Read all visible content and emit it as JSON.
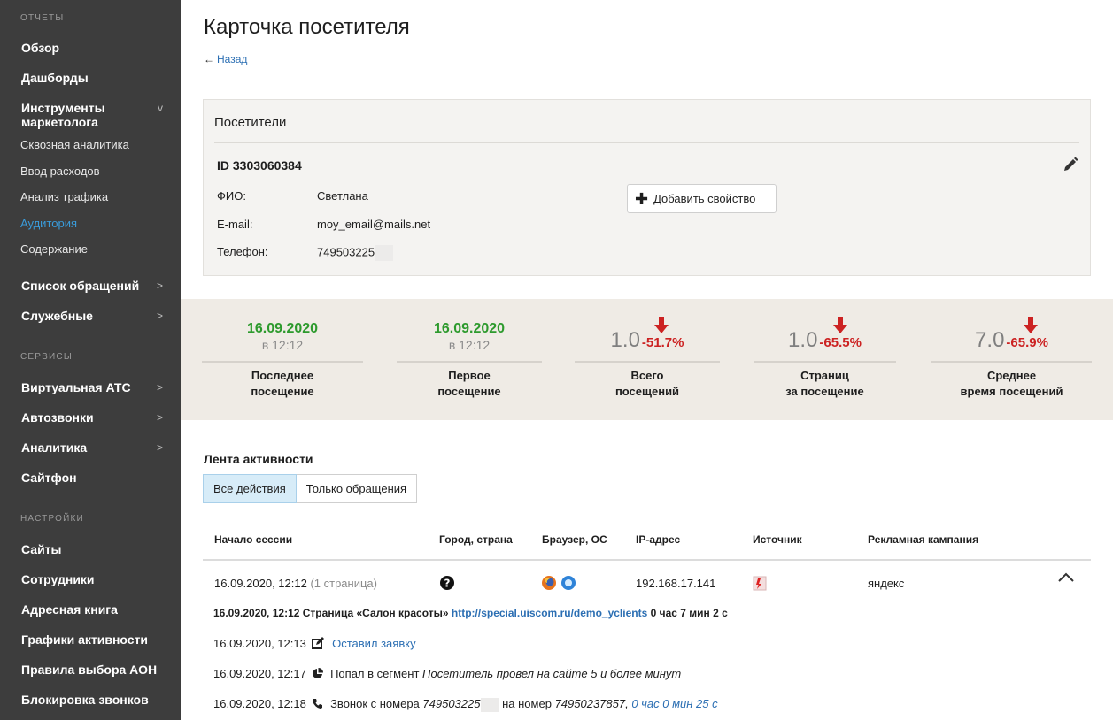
{
  "sidebar": {
    "section_reports": "ОТЧЕТЫ",
    "overview": "Обзор",
    "dashboards": "Дашборды",
    "marketer_tools": "Инструменты маркетолога",
    "marketer_tools_chevron": "v",
    "sub": [
      "Сквозная аналитика",
      "Ввод расходов",
      "Анализ трафика",
      "Аудитория",
      "Содержание"
    ],
    "requests_list": "Список обращений",
    "service": "Служебные",
    "section_services": "СЕРВИСЫ",
    "virtual_pbx": "Виртуальная АТС",
    "autocalls": "Автозвонки",
    "analytics": "Аналитика",
    "sitephone": "Сайтфон",
    "section_settings": "НАСТРОЙКИ",
    "sites": "Сайты",
    "employees": "Сотрудники",
    "address_book": "Адресная книга",
    "activity_charts": "Графики активности",
    "aon_rules": "Правила выбора АОН",
    "call_block": "Блокировка звонков",
    "chevron": ">"
  },
  "page": {
    "title": "Карточка посетителя",
    "back": "Назад"
  },
  "visitor": {
    "card_title": "Посетители",
    "id": "ID 3303060384",
    "name_label": "ФИО:",
    "name_value": "Светлана",
    "email_label": "E-mail:",
    "email_value": "moy_email@mails.net",
    "phone_label": "Телефон:",
    "phone_value": "749503225",
    "add_property": "Добавить свойство"
  },
  "stats": {
    "last_date": "16.09.2020",
    "last_time": "в 12:12",
    "last_label_1": "Последнее",
    "last_label_2": "посещение",
    "first_date": "16.09.2020",
    "first_time": "в 12:12",
    "first_label_1": "Первое",
    "first_label_2": "посещение",
    "total_value": "1.0",
    "total_pct": "-51.7%",
    "total_label_1": "Всего",
    "total_label_2": "посещений",
    "pages_value": "1.0",
    "pages_pct": "-65.5%",
    "pages_label_1": "Страниц",
    "pages_label_2": "за посещение",
    "time_value": "7.0",
    "time_pct": "-65.9%",
    "time_label_1": "Среднее",
    "time_label_2": "время посещений",
    "down_color": "#cc2222",
    "up_color": "#2d9a2d"
  },
  "feed": {
    "title": "Лента активности",
    "tab_all": "Все действия",
    "tab_requests": "Только обращения",
    "headers": {
      "session_start": "Начало сессии",
      "city": "Город, страна",
      "browser": "Браузер, ОС",
      "ip": "IP-адрес",
      "source": "Источник",
      "campaign": "Рекламная кампания"
    },
    "session": {
      "start": "16.09.2020, 12:12",
      "pages": "(1 страница)",
      "ip": "192.168.17.141",
      "campaign": "яндекс"
    },
    "events": {
      "e1_time": "16.09.2020, 12:12",
      "e1_text": "Страница «Салон красоты»",
      "e1_url": "http://special.uiscom.ru/demo_yclients",
      "e1_duration": "0 час 7 мин 2 с",
      "e2_time": "16.09.2020, 12:13",
      "e2_text": "Оставил заявку",
      "e3_time": "16.09.2020, 12:17",
      "e3_text": "Попал в сегмент",
      "e3_segment": "Посетитель провел на сайте 5 и более минут",
      "e4_time": "16.09.2020, 12:18",
      "e4_text1": "Звонок с номера",
      "e4_from": "749503225",
      "e4_text2": "на номер",
      "e4_to": "74950237857,",
      "e4_duration": "0 час 0 мин 25 с"
    }
  }
}
